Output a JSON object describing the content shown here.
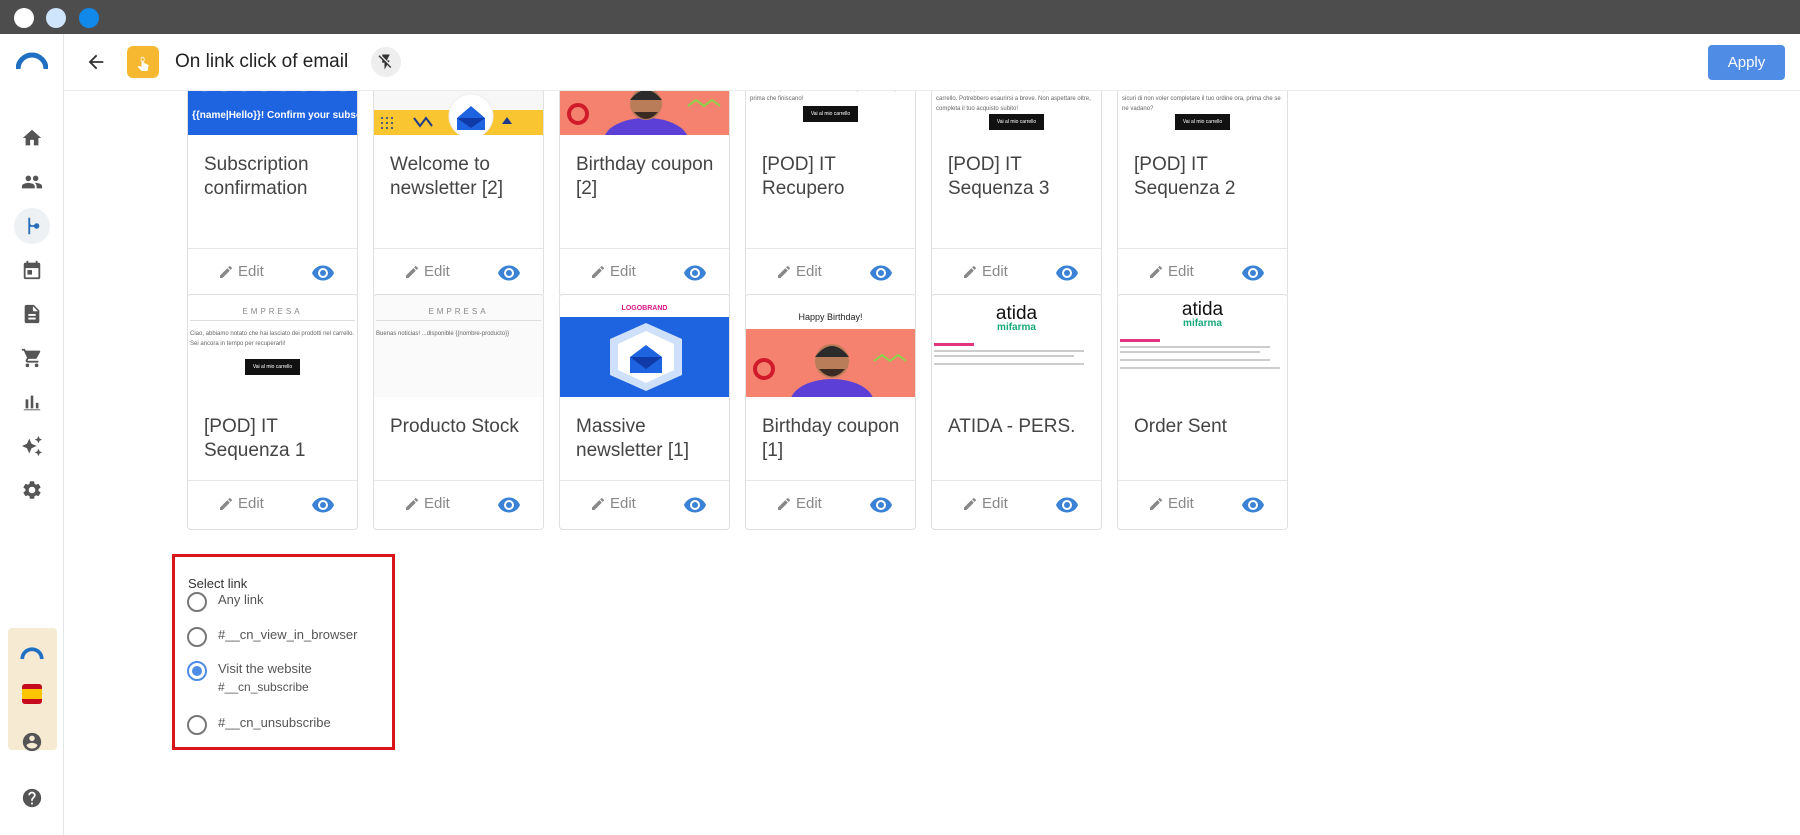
{
  "header": {
    "title": "On link click of email",
    "apply_label": "Apply"
  },
  "sidebar": {
    "items": [
      "home-icon",
      "contacts-icon",
      "automation-icon",
      "calendar-icon",
      "templates-icon",
      "cart-icon",
      "reports-icon",
      "ai-sparkle-icon",
      "settings-icon"
    ],
    "bottom": [
      "account-icon",
      "help-icon"
    ]
  },
  "templates": {
    "row1": [
      {
        "title": "Subscription confirmation",
        "thumb_text": "{{name|Hello}}! Confirm your subscr... You just need to click on the butto..."
      },
      {
        "title": "Welcome to newsletter [2]"
      },
      {
        "title": "Birthday coupon [2]"
      },
      {
        "title": "[POD] IT Recupero",
        "thumb_text": "Sai! Ecco i prodotti del tuo carrello. Completa il tuo acquisto prima che finiscano!",
        "thumb_btn": "Vai al mio carrello"
      },
      {
        "title": "[POD] IT Sequenza 3",
        "thumb_text": "Sai! Ultima opportunità per recuperare i prodotti del tuo carrello. Potrebbero esaurirsi a breve. Non aspettare oltre, completa il tuo acquisto subito!",
        "thumb_btn": "Vai al mio carrello"
      },
      {
        "title": "[POD] IT Sequenza 2",
        "thumb_text": "Sai! I tuoi prodotti ti aspettano ancora nel carrello. Siamo sicuri di non voler completare il tuo ordine ora, prima che se ne vadano?",
        "thumb_btn": "Vai al mio carrello"
      }
    ],
    "row2": [
      {
        "title": "[POD] IT Sequenza 1",
        "thumb_brand": "EMPRESA",
        "thumb_text": "Ciao, abbiamo notato che hai lasciato dei prodotti nel carrello. Sei ancora in tempo per recuperarli!",
        "thumb_btn": "Vai al mio carrello"
      },
      {
        "title": "Producto Stock",
        "thumb_brand": "EMPRESA",
        "thumb_text": "Buenas noticias! ...disponible {{nombre-producto}}"
      },
      {
        "title": "Massive newsletter [1]",
        "thumb_brand": "LOGOBRAND"
      },
      {
        "title": "Birthday coupon [1]",
        "thumb_text": "Happy Birthday!"
      },
      {
        "title": "ATIDA - PERS.",
        "thumb_brand": "atida",
        "thumb_sub": "mifarma"
      },
      {
        "title": "Order Sent",
        "thumb_brand": "atida",
        "thumb_sub": "mifarma"
      }
    ],
    "edit_label": "Edit"
  },
  "select_link": {
    "label": "Select link",
    "options": [
      {
        "label": "Any link",
        "selected": false
      },
      {
        "label": "#__cn_view_in_browser",
        "selected": false
      },
      {
        "label": "Visit the website",
        "sub": "#__cn_subscribe",
        "selected": true
      },
      {
        "label": "#__cn_unsubscribe",
        "selected": false
      }
    ]
  },
  "colors": {
    "accent": "#4e8ce6",
    "highlight_border": "#d8161a",
    "trigger_badge": "#f6b830"
  }
}
